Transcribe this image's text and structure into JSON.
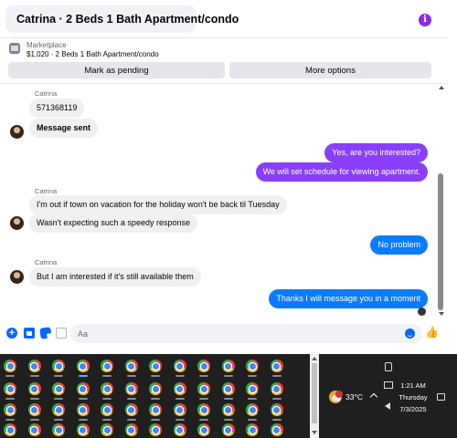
{
  "header": {
    "title": "Catrina · 2 Beds 1 Bath Apartment/condo",
    "info_icon": "info-icon"
  },
  "marketplace": {
    "label": "Marketplace",
    "listing": "$1,020 · 2 Beds 1 Bath Apartment/condo",
    "mark_pending": "Mark as pending",
    "more_options": "More options"
  },
  "messages": {
    "sender1": "Catrina",
    "m1": "571368119",
    "m2": "Message sent",
    "m3": "Yes, are you interested?",
    "m4": "We will set schedule for viewing apartment.",
    "sender2": "Catrina",
    "m5": "I'm out if town on vacation for the holiday won't be back til Tuesday",
    "m6": "Wasn't expecting such a speedy response",
    "m7": "No problem",
    "sender3": "Catrina",
    "m8": "But I am interested if it's still available them",
    "m9": "Thanks I will message you in a moment"
  },
  "composer": {
    "placeholder": "Aa"
  },
  "colors": {
    "outgoing_blue": "#0a7cff",
    "outgoing_purple": "#8a3ffc",
    "incoming_gray": "#f0f0f0",
    "messenger_blue": "#0866ff"
  },
  "taskbar": {
    "app_icon": "chrome-icon",
    "temperature": "33°C",
    "time": "1:21 AM",
    "day": "Thursday",
    "date": "7/3/2025"
  }
}
